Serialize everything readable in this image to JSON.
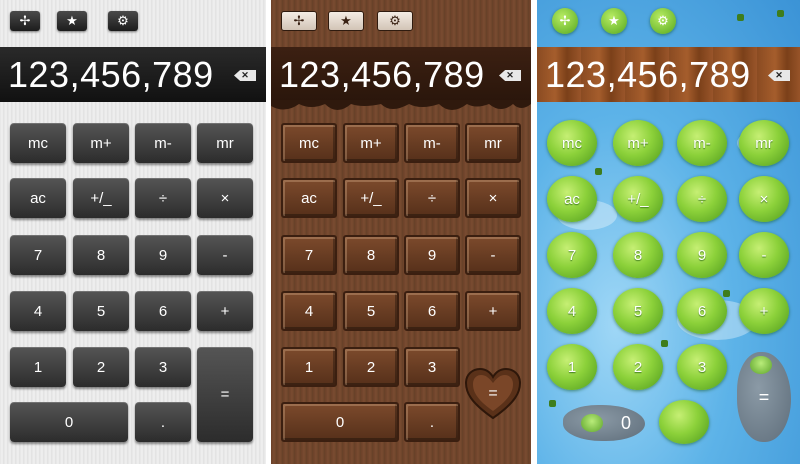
{
  "top_icons": [
    "move-icon",
    "star-icon",
    "gear-icon"
  ],
  "top_glyphs": [
    "✢",
    "★",
    "⚙"
  ],
  "display": {
    "value": "123,456,789",
    "backspace": "✕"
  },
  "keys": {
    "mc": "mc",
    "m_plus": "m+",
    "m_minus": "m-",
    "mr": "mr",
    "ac": "ac",
    "plus_minus": "+/_",
    "divide": "÷",
    "multiply": "×",
    "d7": "7",
    "d8": "8",
    "d9": "9",
    "minus": "-",
    "d4": "4",
    "d5": "5",
    "d6": "6",
    "plus": "+",
    "d1": "1",
    "d2": "2",
    "d3": "3",
    "equals": "=",
    "d0": "0",
    "dot": "."
  },
  "themes": {
    "silver": {
      "display_bg": "#1a1a1a",
      "key_bg": "#3a3a3a"
    },
    "chocolate": {
      "display_bg": "#2f190d",
      "key_bg": "#6a3b22"
    },
    "pond": {
      "display_bg": "#95522a",
      "key_bg": "#8cd13a"
    }
  }
}
